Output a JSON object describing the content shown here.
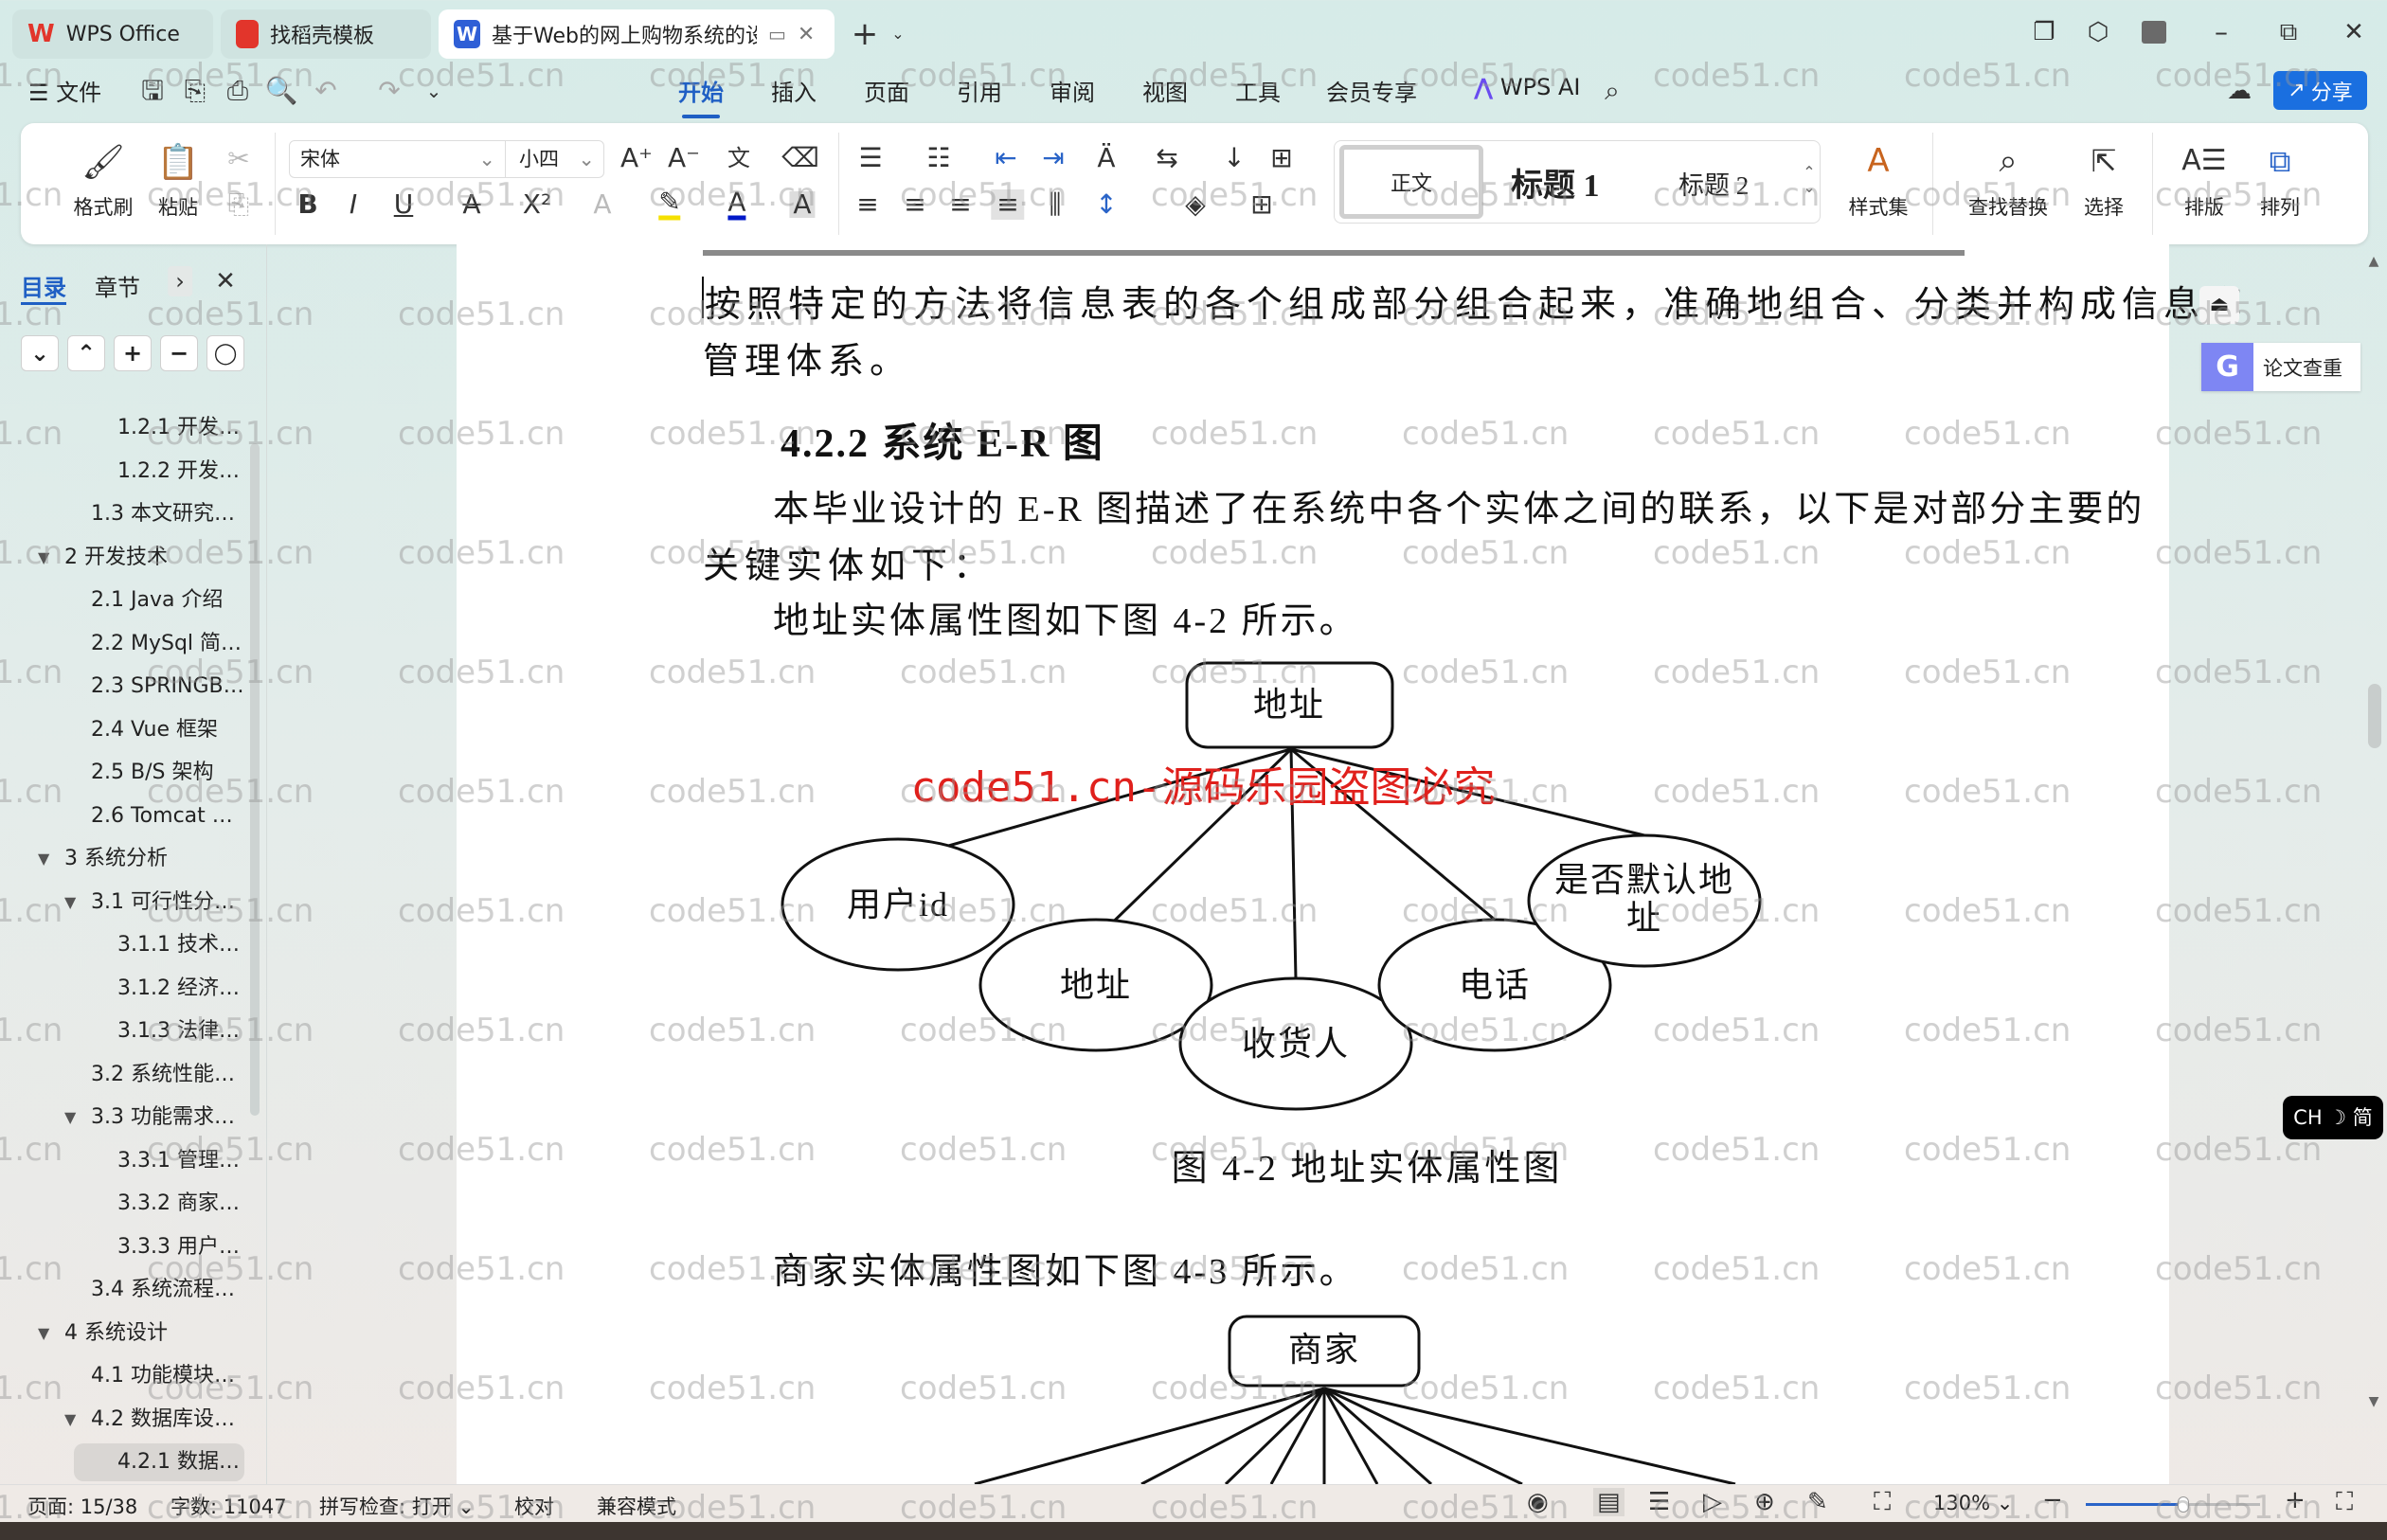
{
  "tabs": [
    {
      "label": "WPS Office",
      "icon": "wps-logo-icon",
      "color": "#e2352b"
    },
    {
      "label": "找稻壳模板",
      "icon": "docer-logo-icon",
      "color": "#e2352b"
    },
    {
      "label": "基于Web的网上购物系统的设",
      "icon": "word-doc-icon",
      "color": "#2f5fd6",
      "active": true
    }
  ],
  "menu": {
    "file": "文件",
    "items": [
      "开始",
      "插入",
      "页面",
      "引用",
      "审阅",
      "视图",
      "工具",
      "会员专享"
    ],
    "active": "开始",
    "wps_ai": "WPS AI",
    "share": "分享"
  },
  "ribbon": {
    "format_painter": "格式刷",
    "paste": "粘贴",
    "font": "宋体",
    "font_size": "小四",
    "styles": {
      "normal": "正文",
      "h1": "标题 1",
      "h2": "标题 2"
    },
    "style_set": "样式集",
    "find_replace": "查找替换",
    "select": "选择",
    "layout": "排版",
    "arrange": "排列"
  },
  "sidebar": {
    "tab_toc": "目录",
    "tab_chapter": "章节",
    "items": [
      {
        "label": "1.2.1 开发…",
        "level": 3
      },
      {
        "label": "1.2.2 开发…",
        "level": 3
      },
      {
        "label": "1.3 本文研究…",
        "level": 2
      },
      {
        "label": "2 开发技术",
        "level": 1,
        "expanded": true
      },
      {
        "label": "2.1 Java 介绍",
        "level": 2
      },
      {
        "label": "2.2 MySql 简…",
        "level": 2
      },
      {
        "label": "2.3 SPRINGB…",
        "level": 2
      },
      {
        "label": "2.4 Vue 框架",
        "level": 2
      },
      {
        "label": "2.5 B/S 架构",
        "level": 2
      },
      {
        "label": "2.6 Tomcat …",
        "level": 2
      },
      {
        "label": "3 系统分析",
        "level": 1,
        "expanded": true
      },
      {
        "label": "3.1 可行性分…",
        "level": 2,
        "expanded": true
      },
      {
        "label": "3.1.1 技术…",
        "level": 3
      },
      {
        "label": "3.1.2 经济…",
        "level": 3
      },
      {
        "label": "3.1.3 法律…",
        "level": 3
      },
      {
        "label": "3.2 系统性能…",
        "level": 2
      },
      {
        "label": "3.3 功能需求…",
        "level": 2,
        "expanded": true
      },
      {
        "label": "3.3.1 管理…",
        "level": 3
      },
      {
        "label": "3.3.2 商家…",
        "level": 3
      },
      {
        "label": "3.3.3 用户…",
        "level": 3
      },
      {
        "label": "3.4 系统流程…",
        "level": 2
      },
      {
        "label": "4 系统设计",
        "level": 1,
        "expanded": true
      },
      {
        "label": "4.1 功能模块…",
        "level": 2
      },
      {
        "label": "4.2 数据库设…",
        "level": 2,
        "expanded": true
      },
      {
        "label": "4.2.1 数据…",
        "level": 3,
        "selected": true
      }
    ]
  },
  "document": {
    "p1_line1": "按照特定的方法将信息表的各个组成部分组合起来，准确地组合、分类并构成信息库",
    "p1_line2": "管理体系。",
    "heading": "4.2.2 系统 E-R 图",
    "p2_line1": "本毕业设计的 E-R 图描述了在系统中各个实体之间的联系，以下是对部分主要的",
    "p2_line2": "关键实体如下：",
    "p3": "地址实体属性图如下图 4-2 所示。",
    "fig1": {
      "entity": "地址",
      "attributes": [
        "用户id",
        "地址",
        "收货人",
        "电话",
        "是否默认地址"
      ],
      "caption": "图 4-2 地址实体属性图"
    },
    "stamp": "code51.cn-源码乐园盗图必究",
    "p4": "商家实体属性图如下图 4-3 所示。",
    "fig2": {
      "entity": "商家"
    }
  },
  "right_panel": {
    "plagiarism_check": "论文查重",
    "ime": "CH ☽ 简"
  },
  "status": {
    "page": "页面: 15/38",
    "words": "字数: 11047",
    "spell": "拼写检查: 打开",
    "proof": "校对",
    "compat": "兼容模式",
    "zoom": "130%",
    "zoom_percent": 130
  },
  "watermark": "code51.cn",
  "colors": {
    "accent": "#1f5fc4",
    "stamp": "#e0201c",
    "share_button": "#1a6fe0"
  }
}
